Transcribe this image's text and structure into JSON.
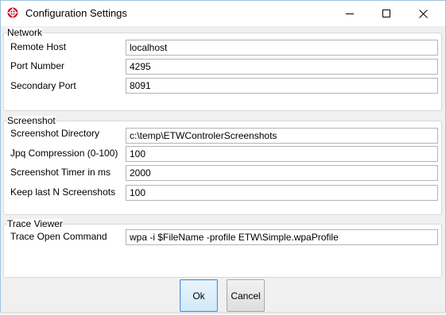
{
  "window": {
    "title": "Configuration Settings",
    "icon": "etw-app-icon",
    "accent_color": "#d01030",
    "controls": {
      "minimize_icon": "minimize-icon",
      "maximize_icon": "maximize-icon",
      "close_icon": "close-icon"
    }
  },
  "groups": {
    "network": {
      "label": "Network",
      "fields": [
        {
          "label": "Remote Host",
          "value": "localhost"
        },
        {
          "label": "Port Number",
          "value": "4295"
        },
        {
          "label": "Secondary Port",
          "value": "8091"
        }
      ]
    },
    "screenshot": {
      "label": "Screenshot",
      "fields": [
        {
          "label": "Screenshot Directory",
          "value": "c:\\temp\\ETWControlerScreenshots"
        },
        {
          "label": "Jpq Compression (0-100)",
          "value": "100"
        },
        {
          "label": "Screenshot Timer in ms",
          "value": "2000"
        },
        {
          "label": "Keep last N Screenshots",
          "value": "100"
        }
      ]
    },
    "trace_viewer": {
      "label": "Trace Viewer",
      "fields": [
        {
          "label": "Trace Open Command",
          "value": "wpa -i $FileName -profile ETW\\Simple.wpaProfile"
        }
      ]
    }
  },
  "buttons": {
    "ok_label": "Ok",
    "cancel_label": "Cancel"
  }
}
